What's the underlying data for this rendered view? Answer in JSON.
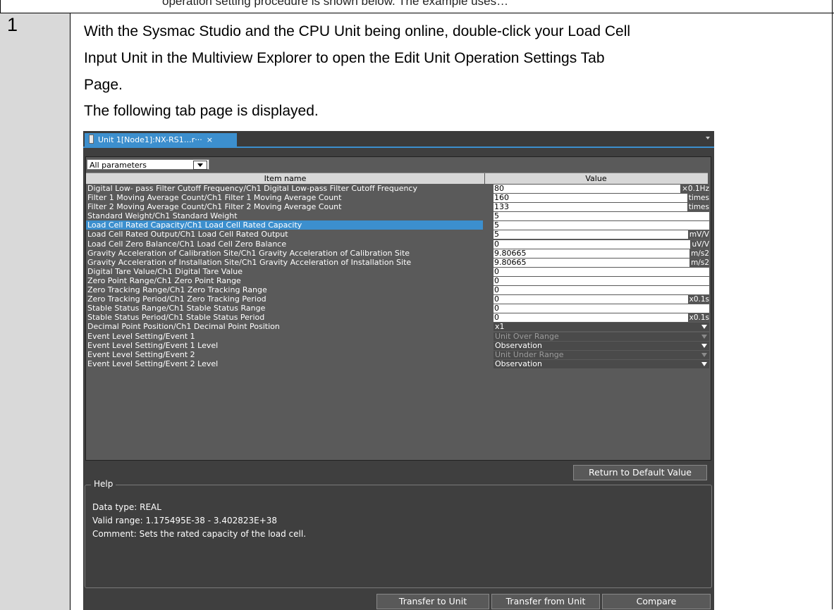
{
  "doc": {
    "cut_line": "operation setting procedure is shown below. The example uses…",
    "step_number": "1",
    "paragraph_lines": [
      "With the Sysmac Studio and the CPU Unit being online, double-click your Load Cell",
      "Input Unit in the Multiview Explorer to open the Edit Unit Operation Settings Tab",
      "Page.",
      "The following tab page is displayed."
    ]
  },
  "app": {
    "tab_label": "Unit 1[Node1]:NX-RS1…r···",
    "tab_close": "×",
    "filter_value": "All parameters",
    "columns": {
      "item": "Item name",
      "value": "Value"
    },
    "rows": [
      {
        "name": "Digital Low- pass Filter Cutoff Frequency/Ch1 Digital Low-pass Filter Cutoff Frequency",
        "value": "80",
        "unit": "×0.1Hz"
      },
      {
        "name": "Filter 1 Moving Average Count/Ch1 Filter 1 Moving Average Count",
        "value": "160",
        "unit": "times"
      },
      {
        "name": "Filter 2 Moving Average Count/Ch1 Filter 2 Moving Average Count",
        "value": "133",
        "unit": "times"
      },
      {
        "name": "Standard Weight/Ch1 Standard Weight",
        "value": "5",
        "unit": ""
      },
      {
        "name": "Load Cell Rated Capacity/Ch1 Load Cell Rated Capacity",
        "value": "5",
        "unit": ""
      },
      {
        "name": "Load Cell Rated Output/Ch1 Load Cell Rated Output",
        "value": "5",
        "unit": "mV/V"
      },
      {
        "name": "Load Cell Zero Balance/Ch1 Load Cell Zero Balance",
        "value": "0",
        "unit": "uV/V"
      },
      {
        "name": "Gravity Acceleration of Calibration Site/Ch1 Gravity Acceleration of Calibration Site",
        "value": "9.80665",
        "unit": "m/s2"
      },
      {
        "name": "Gravity Acceleration of Installation Site/Ch1 Gravity Acceleration of Installation Site",
        "value": "9.80665",
        "unit": "m/s2"
      },
      {
        "name": "Digital Tare Value/Ch1 Digital Tare Value",
        "value": "0",
        "unit": ""
      },
      {
        "name": "Zero Point Range/Ch1 Zero Point Range",
        "value": "0",
        "unit": ""
      },
      {
        "name": "Zero Tracking Range/Ch1 Zero Tracking Range",
        "value": "0",
        "unit": ""
      },
      {
        "name": "Zero Tracking Period/Ch1 Zero Tracking Period",
        "value": "0",
        "unit": "x0.1s"
      },
      {
        "name": "Stable Status Range/Ch1 Stable Status Range",
        "value": "0",
        "unit": ""
      },
      {
        "name": "Stable Status Period/Ch1 Stable Status Period",
        "value": "0",
        "unit": "x0.1s"
      },
      {
        "name": "Decimal Point Position/Ch1 Decimal Point Position",
        "select": "x1",
        "disabled": false
      },
      {
        "name": "Event Level Setting/Event 1",
        "select": "Unit Over Range",
        "disabled": true
      },
      {
        "name": "Event Level Setting/Event 1 Level",
        "select": "Observation",
        "disabled": false
      },
      {
        "name": "Event Level Setting/Event 2",
        "select": "Unit Under Range",
        "disabled": true
      },
      {
        "name": "Event Level Setting/Event 2 Level",
        "select": "Observation",
        "disabled": false
      }
    ],
    "selected_row": 4,
    "return_default_label": "Return to Default Value",
    "help": {
      "title": "Help",
      "lines": [
        "Data type: REAL",
        "Valid range: 1.175495E-38 - 3.402823E+38",
        "Comment: Sets the rated capacity of the load cell."
      ]
    },
    "bottom_buttons": {
      "transfer_to": "Transfer to Unit",
      "transfer_from": "Transfer from Unit",
      "compare": "Compare"
    }
  }
}
